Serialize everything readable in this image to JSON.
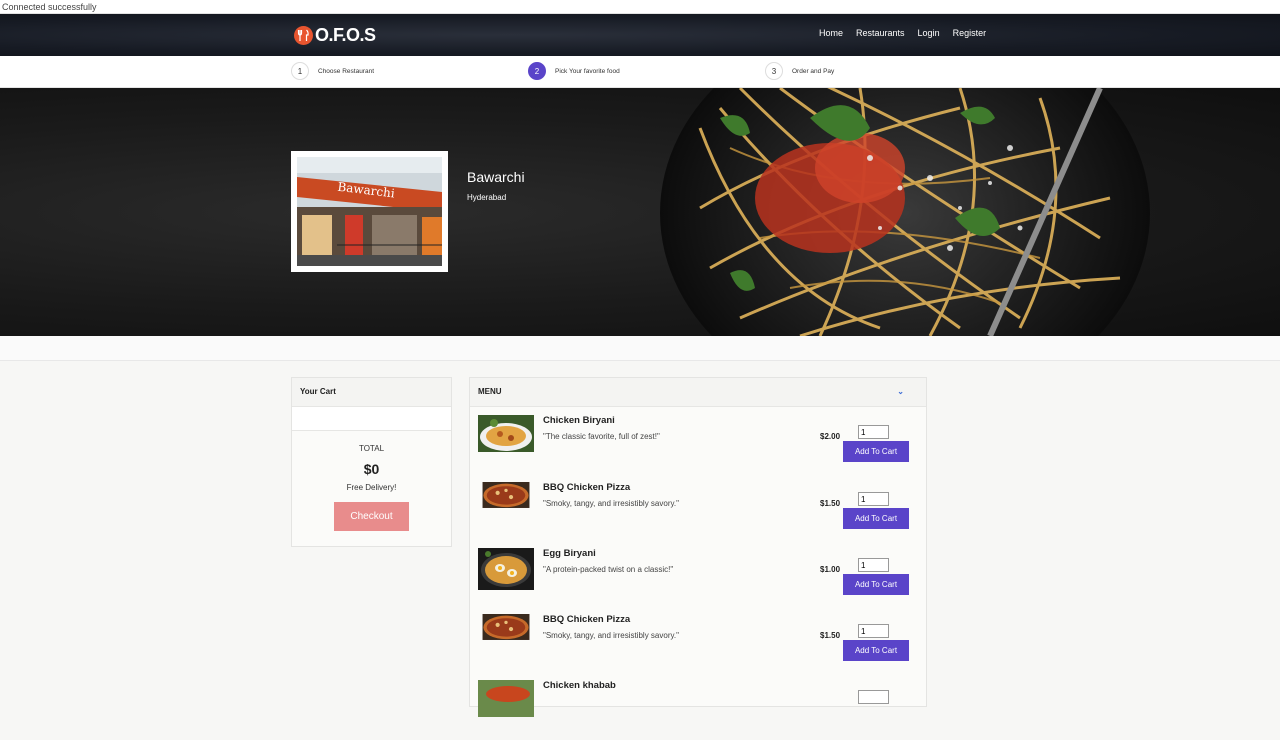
{
  "status_bar": {
    "text": "Connected successfully"
  },
  "brand": {
    "logo_text": "O.F.O.S",
    "accent": "#e8552f"
  },
  "nav": {
    "items": [
      "Home",
      "Restaurants",
      "Login",
      "Register"
    ]
  },
  "steps": [
    {
      "num": "1",
      "label": "Choose Restaurant",
      "active": false
    },
    {
      "num": "2",
      "label": "Pick Your favorite food",
      "active": true
    },
    {
      "num": "3",
      "label": "Order and Pay",
      "active": false
    }
  ],
  "restaurant": {
    "name": "Bawarchi",
    "city": "Hyderabad",
    "sign_text": "Bawarchi"
  },
  "cart": {
    "title": "Your Cart",
    "total_label": "TOTAL",
    "total": "$0",
    "delivery": "Free Delivery!",
    "checkout": "Checkout"
  },
  "menu": {
    "title": "MENU",
    "items": [
      {
        "name": "Chicken Biryani",
        "desc": "\"The classic favorite, full of zest!\"",
        "price": "$2.00",
        "qty": "1",
        "button": "Add To Cart"
      },
      {
        "name": "BBQ Chicken Pizza",
        "desc": "\"Smoky, tangy, and irresistibly savory.\"",
        "price": "$1.50",
        "qty": "1",
        "button": "Add To Cart"
      },
      {
        "name": "Egg Biryani",
        "desc": "\"A protein-packed twist on a classic!\"",
        "price": "$1.00",
        "qty": "1",
        "button": "Add To Cart"
      },
      {
        "name": "BBQ Chicken Pizza",
        "desc": "\"Smoky, tangy, and irresistibly savory.\"",
        "price": "$1.50",
        "qty": "1",
        "button": "Add To Cart"
      },
      {
        "name": "Chicken khabab",
        "desc": "",
        "price": "",
        "qty": "",
        "button": ""
      }
    ]
  },
  "colors": {
    "primary": "#5a44c9",
    "checkout": "#e88c8c",
    "navbar": "#171b24"
  }
}
